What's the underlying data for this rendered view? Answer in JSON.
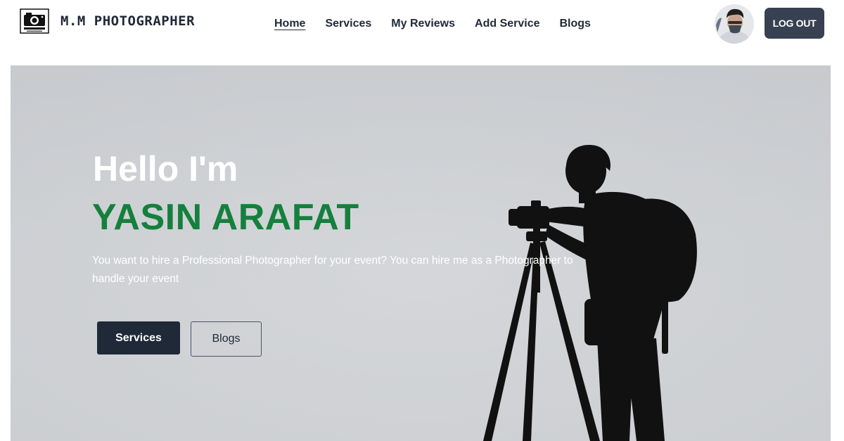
{
  "brand": {
    "name": "M.M PHOTOGRAPHER",
    "logo_icon": "camera-logo-icon"
  },
  "nav": {
    "items": [
      {
        "label": "Home",
        "active": true
      },
      {
        "label": "Services",
        "active": false
      },
      {
        "label": "My Reviews",
        "active": false
      },
      {
        "label": "Add Service",
        "active": false
      },
      {
        "label": "Blogs",
        "active": false
      }
    ]
  },
  "user": {
    "avatar_icon": "user-avatar",
    "logout_label": "LOG OUT"
  },
  "hero": {
    "greeting": "Hello I'm",
    "name": "YASIN ARAFAT",
    "description": "You want to hire a Professional Photographer for your event? You can hire me as a Photographer to handle your event",
    "primary_button": "Services",
    "secondary_button": "Blogs",
    "photo": "photographer-silhouette-with-tripod"
  },
  "colors": {
    "name_accent": "#15803d",
    "dark_button": "#1f2937",
    "logout_button": "#374151",
    "hero_background": "#cfd2d5"
  }
}
